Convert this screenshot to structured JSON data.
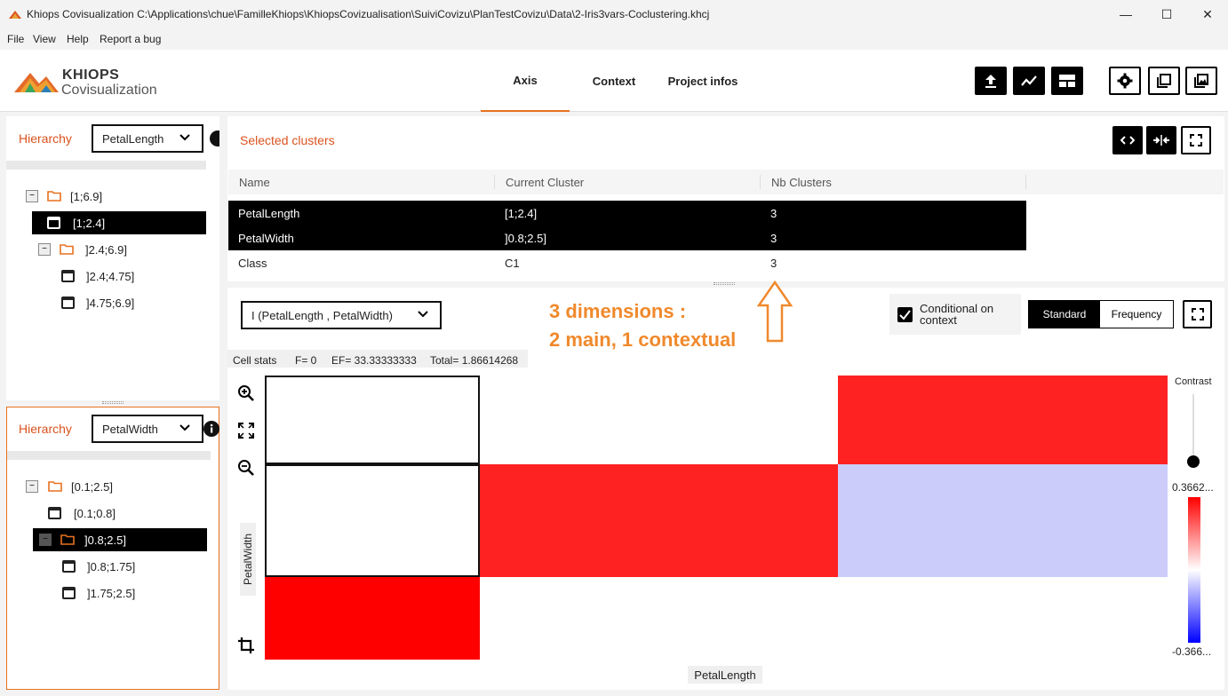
{
  "window": {
    "title": "Khiops Covisualization C:\\Applications\\chue\\FamilleKhiops\\KhiopsCovizualisation\\SuiviCovizu\\PlanTestCovizu\\Data\\2-Iris3vars-Coclustering.khcj",
    "min": "—",
    "max": "☐",
    "close": "✕"
  },
  "menu": {
    "file": "File",
    "view": "View",
    "help": "Help",
    "report": "Report a bug"
  },
  "brand": {
    "line1": "KHIOPS",
    "line2": "Covisualization"
  },
  "tabs": [
    {
      "label": "Axis"
    },
    {
      "label": "Context"
    },
    {
      "label": "Project infos"
    }
  ],
  "left_top": {
    "hierarchy_label": "Hierarchy",
    "dimension": "PetalLength",
    "nodes": [
      {
        "label": "[1;6.9]"
      },
      {
        "label": "[1;2.4]"
      },
      {
        "label": "]2.4;6.9]"
      },
      {
        "label": "]2.4;4.75]"
      },
      {
        "label": "]4.75;6.9]"
      }
    ]
  },
  "left_bottom": {
    "hierarchy_label": "Hierarchy",
    "dimension": "PetalWidth",
    "nodes": [
      {
        "label": "[0.1;2.5]"
      },
      {
        "label": "[0.1;0.8]"
      },
      {
        "label": "]0.8;2.5]"
      },
      {
        "label": "]0.8;1.75]"
      },
      {
        "label": "]1.75;2.5]"
      }
    ]
  },
  "selected_clusters": {
    "title": "Selected clusters",
    "columns": [
      "Name",
      "Current Cluster",
      "Nb Clusters"
    ],
    "rows": [
      {
        "name": "PetalLength",
        "cluster": "[1;2.4]",
        "nb": "3"
      },
      {
        "name": "PetalWidth",
        "cluster": "]0.8;2.5]",
        "nb": "3"
      },
      {
        "name": "Class",
        "cluster": "C1",
        "nb": "3"
      }
    ]
  },
  "matrix": {
    "mode_select": "I (PetalLength , PetalWidth)",
    "annotation_line1": "3 dimensions :",
    "annotation_line2": "2 main, 1 contextual",
    "conditional_label": "Conditional on context",
    "conditional_checked": true,
    "toggle_standard": "Standard",
    "toggle_frequency": "Frequency",
    "cell_stats": {
      "label": "Cell stats",
      "f": "F= 0",
      "ef": "EF= 33.33333333",
      "total": "Total= 1.86614268"
    },
    "xlabel": "PetalLength",
    "ylabel": "PetalWidth",
    "contrast_label": "Contrast",
    "legend_max": "0.3662...",
    "legend_min": "-0.366...",
    "colors": {
      "red": "#fe2222",
      "red2": "#ff0000",
      "lavender": "#ccccfb",
      "white": "#ffffff"
    }
  }
}
